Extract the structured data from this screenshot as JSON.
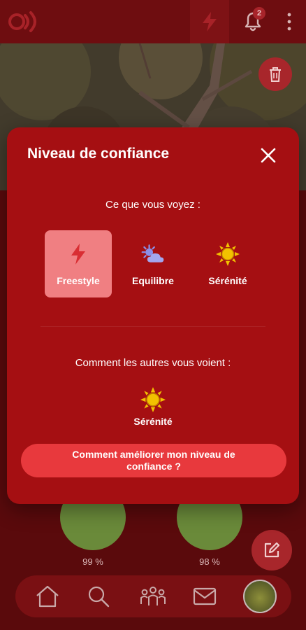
{
  "topbar": {
    "logo_icon": "brand-logo-icon",
    "bolt_icon": "lightning-icon",
    "bell_icon": "bell-icon",
    "notification_count": "2",
    "menu_icon": "kebab-menu-icon"
  },
  "photo": {
    "trash_icon": "trash-icon"
  },
  "modal": {
    "title": "Niveau de confiance",
    "close_icon": "close-icon",
    "what_you_see_label": "Ce que vous voyez :",
    "options": [
      {
        "label": "Freestyle",
        "icon": "lightning-icon",
        "selected": true
      },
      {
        "label": "Equilibre",
        "icon": "sun-cloud-icon",
        "selected": false
      },
      {
        "label": "Sérénité",
        "icon": "sun-icon",
        "selected": false
      }
    ],
    "how_others_see_label": "Comment les autres vous voient :",
    "others_see_value": "Sérénité",
    "improve_button": "Comment améliorer mon niveau de confiance ?"
  },
  "feed": {
    "scores": [
      "99 %",
      "98 %"
    ]
  },
  "bottom_nav": {
    "items": [
      "home-icon",
      "search-icon",
      "community-icon",
      "mail-icon",
      "avatar"
    ]
  },
  "colors": {
    "modal_bg": "#a50f12",
    "selected_option": "#f07f82",
    "primary_button": "#e8393d",
    "sun_yellow": "#f2c200",
    "equilibre_blue": "#8b8fe8"
  }
}
